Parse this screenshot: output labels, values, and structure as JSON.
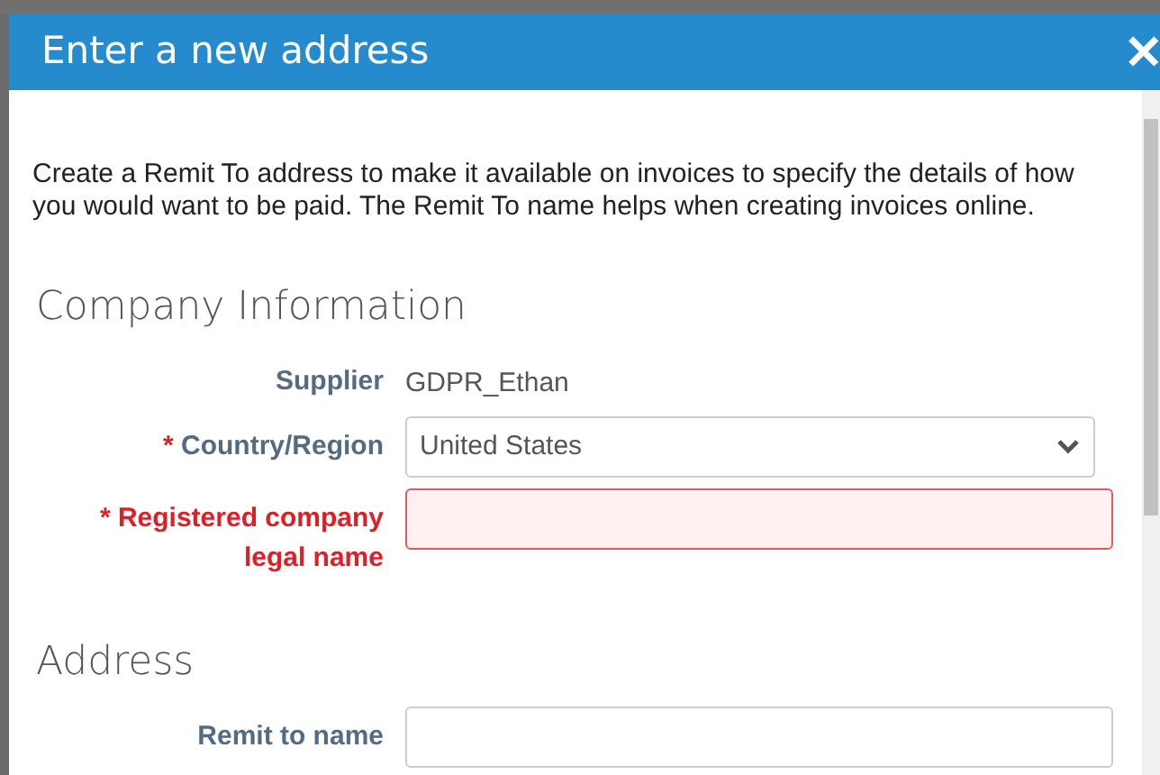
{
  "dialog": {
    "title": "Enter a new address",
    "close": "✕"
  },
  "required_mark": "*",
  "description": "Create a Remit To address to make it available on invoices to specify the details of how you would want to be paid. The Remit To name helps when creating invoices online.",
  "sections": [
    {
      "heading": "Company Information",
      "fields": [
        {
          "kind": "static",
          "label": "Supplier",
          "required": false,
          "error": false,
          "value": "GDPR_Ethan"
        },
        {
          "kind": "select",
          "label": "Country/Region",
          "required": true,
          "error": false,
          "value": "United States"
        },
        {
          "kind": "text",
          "label": "Registered company legal name",
          "required": true,
          "error": true
        }
      ]
    },
    {
      "heading": "Address",
      "fields": [
        {
          "kind": "text",
          "label": "Remit to name",
          "required": false,
          "error": false
        }
      ]
    }
  ]
}
